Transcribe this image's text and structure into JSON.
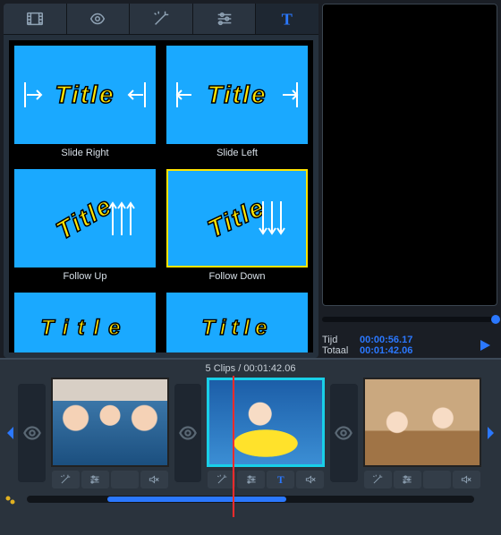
{
  "tabs": [
    {
      "id": "clips-tab",
      "icon": "film"
    },
    {
      "id": "transitions-tab",
      "icon": "swirl"
    },
    {
      "id": "effects-tab",
      "icon": "wand"
    },
    {
      "id": "adjust-tab",
      "icon": "sliders"
    },
    {
      "id": "titles-tab",
      "icon": "text"
    }
  ],
  "title_presets": {
    "word": "Title",
    "items": [
      {
        "label": "Slide Right",
        "selected": false,
        "style": "slide-right"
      },
      {
        "label": "Slide Left",
        "selected": false,
        "style": "slide-left"
      },
      {
        "label": "Follow Up",
        "selected": false,
        "style": "follow-up"
      },
      {
        "label": "Follow Down",
        "selected": true,
        "style": "follow-down"
      },
      {
        "label": "",
        "selected": false,
        "style": "spread-a"
      },
      {
        "label": "",
        "selected": false,
        "style": "spread-b"
      }
    ]
  },
  "time_label": "Tijd",
  "total_label": "Totaal",
  "time_value": "00:00:56.17",
  "total_value": "00:01:42.06",
  "storyboard_header": "5 Clips / 00:01:42.06",
  "clip_buttons": [
    "wand",
    "sliders",
    "text",
    "mute"
  ],
  "clips": [
    {
      "photo": "photo1",
      "selected": false,
      "title_on": false
    },
    {
      "photo": "photo2",
      "selected": true,
      "title_on": true
    },
    {
      "photo": "photo3",
      "selected": false,
      "title_on": false
    }
  ]
}
